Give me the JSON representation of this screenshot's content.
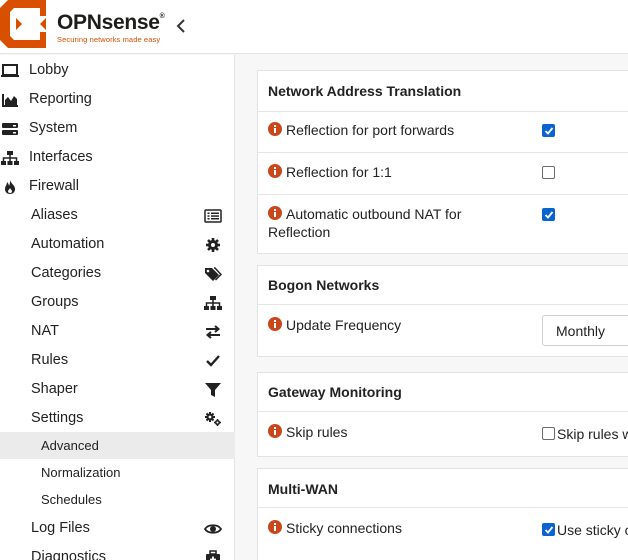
{
  "header": {
    "brand_prefix": "OPN",
    "brand_suffix": "sense",
    "trademark": "®",
    "tagline": "Securing networks made easy"
  },
  "sidebar": {
    "items": [
      {
        "label": "Lobby",
        "icon": "laptop-icon"
      },
      {
        "label": "Reporting",
        "icon": "area-chart-icon"
      },
      {
        "label": "System",
        "icon": "server-icon"
      },
      {
        "label": "Interfaces",
        "icon": "sitemap-icon"
      },
      {
        "label": "Firewall",
        "icon": "fire-icon"
      }
    ],
    "firewall_sub": [
      {
        "label": "Aliases",
        "icon": "list-alt-icon"
      },
      {
        "label": "Automation",
        "icon": "cog-icon"
      },
      {
        "label": "Categories",
        "icon": "tags-icon"
      },
      {
        "label": "Groups",
        "icon": "sitemap-icon"
      },
      {
        "label": "NAT",
        "icon": "exchange-icon"
      },
      {
        "label": "Rules",
        "icon": "check-icon"
      },
      {
        "label": "Shaper",
        "icon": "filter-icon"
      },
      {
        "label": "Settings",
        "icon": "cogs-icon"
      }
    ],
    "settings_sub": [
      {
        "label": "Advanced",
        "active": true
      },
      {
        "label": "Normalization",
        "active": false
      },
      {
        "label": "Schedules",
        "active": false
      }
    ],
    "more": [
      {
        "label": "Log Files",
        "icon": "eye-icon"
      },
      {
        "label": "Diagnostics",
        "icon": "medkit-icon"
      }
    ]
  },
  "sections": {
    "nat": {
      "title": "Network Address Translation",
      "rows": [
        {
          "label": "Reflection for port forwards",
          "checked": true
        },
        {
          "label": "Reflection for 1:1",
          "checked": false
        },
        {
          "label": "Automatic outbound NAT for Reflection",
          "checked": true
        }
      ]
    },
    "bogon": {
      "title": "Bogon Networks",
      "update_label": "Update Frequency",
      "update_value": "Monthly"
    },
    "gateway": {
      "title": "Gateway Monitoring",
      "skip_label": "Skip rules",
      "skip_checkbox_text": "Skip rules w",
      "skip_checked": false
    },
    "multiwan": {
      "title": "Multi-WAN",
      "sticky_label": "Sticky connections",
      "sticky_checkbox_text": "Use sticky c",
      "sticky_checked": true
    }
  },
  "colors": {
    "brand_orange": "#d94f00",
    "checkbox_blue": "#0b63d0",
    "info_icon": "#c9471a",
    "active_bg": "#ebebeb"
  }
}
